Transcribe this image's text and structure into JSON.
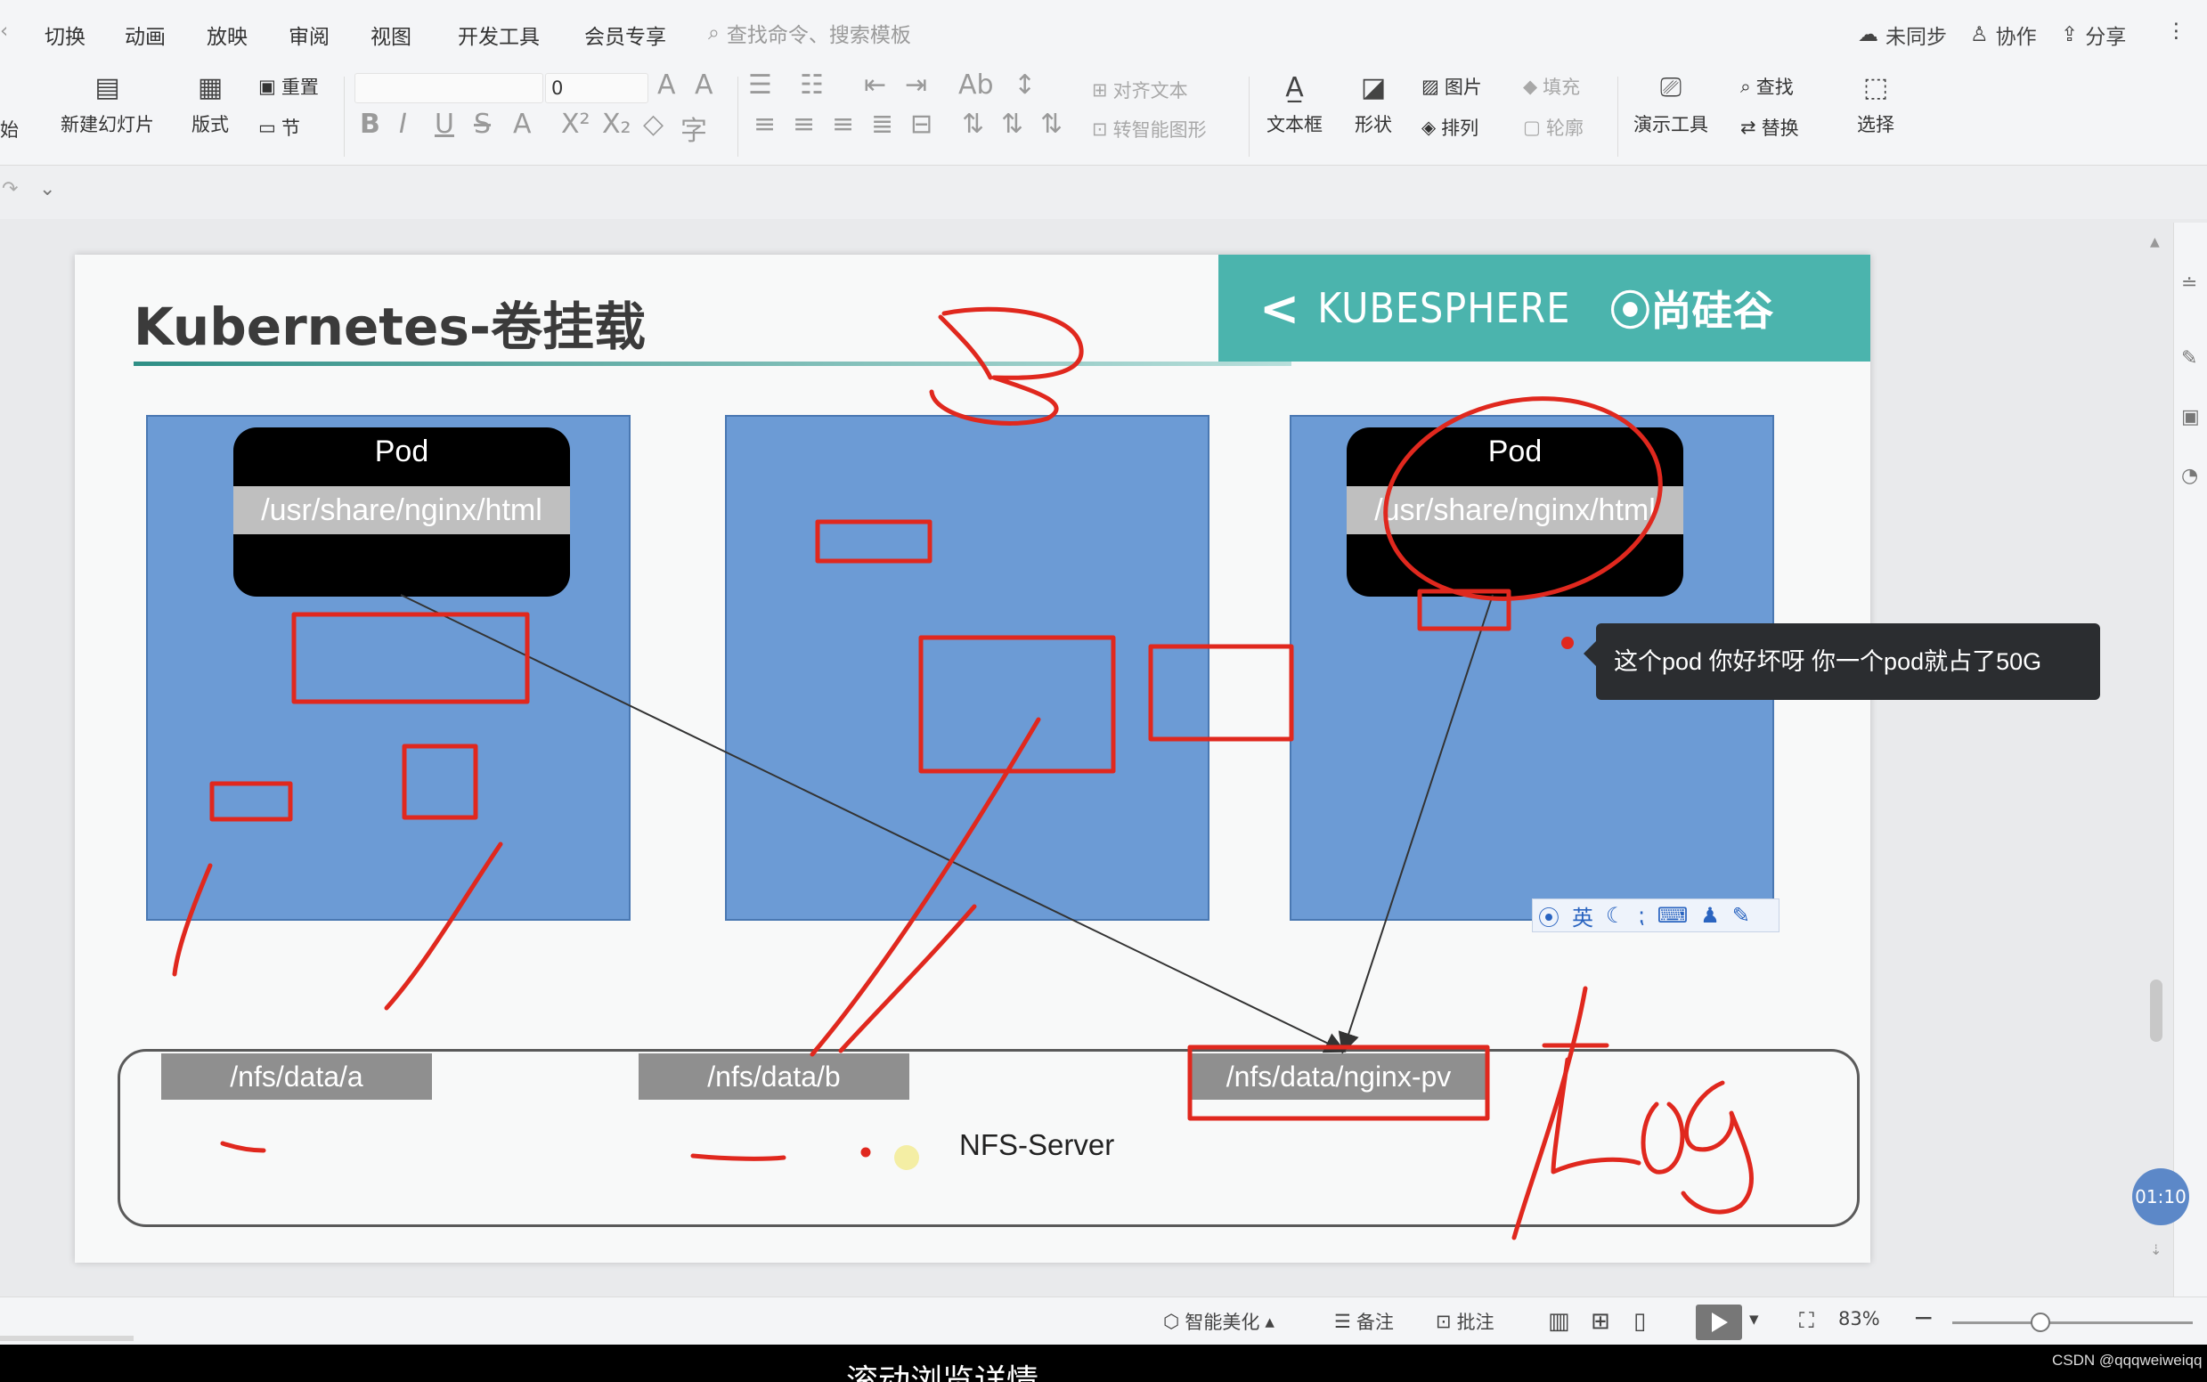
{
  "menu": {
    "tabs": [
      "切换",
      "动画",
      "放映",
      "审阅",
      "视图",
      "开发工具",
      "会员专享"
    ],
    "search_placeholder": "查找命令、搜索模板",
    "right": [
      "未同步",
      "协作",
      "分享"
    ]
  },
  "ribbon": {
    "left_cut": "始",
    "new_slide": "新建幻灯片",
    "layout": "版式",
    "reset": "重置",
    "section": "节",
    "font_size": "0",
    "align_text": "对齐文本",
    "smart_shape": "转智能图形",
    "textbox": "文本框",
    "shape": "形状",
    "picture": "图片",
    "arrange": "排列",
    "fill": "填充",
    "outline": "轮廓",
    "presenter_tools": "演示工具",
    "find": "查找",
    "replace": "替换",
    "select": "选择"
  },
  "slide": {
    "title": "Kubernetes-卷挂载",
    "logo_kubesphere": "KUBESPHERE",
    "logo_sgg": "尚硅谷",
    "pod1": {
      "label": "Pod",
      "path": "/usr/share/nginx/html"
    },
    "pod2": {
      "label": "Pod",
      "path": "/usr/share/nginx/html"
    },
    "nfs_paths": [
      "/nfs/data/a",
      "/nfs/data/b",
      "/nfs/data/nginx-pv"
    ],
    "nfs_label": "NFS-Server",
    "ime": {
      "lang": "英"
    }
  },
  "comment": "这个pod 你好坏呀 你一个pod就占了50G",
  "timer": "01:10",
  "status": {
    "beautify": "智能美化",
    "notes": "备注",
    "annotate": "批注",
    "zoom": "83%"
  },
  "caption": "滚动浏览详情",
  "watermark": "CSDN @qqqweiweiqq",
  "colors": {
    "accent_teal": "#4bb4ad",
    "node_blue": "#6c9bd5",
    "annotation_red": "#e0281e"
  }
}
